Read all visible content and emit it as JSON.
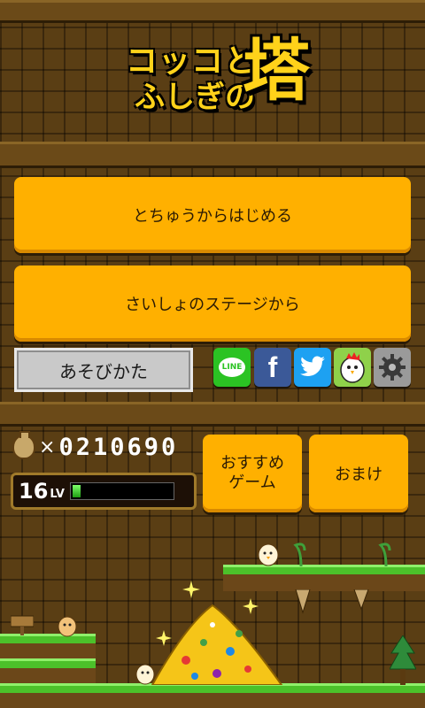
{
  "title": {
    "line1": "コッコと",
    "line2": "ふしぎの",
    "big": "塔"
  },
  "menu": {
    "continue_label": "とちゅうからはじめる",
    "start_label": "さいしょのステージから",
    "howto_label": "あそびかた"
  },
  "social": {
    "line_label": "LINE",
    "facebook_label": "f"
  },
  "status": {
    "coins_x": "×",
    "coins": "0210690",
    "level": "16",
    "level_unit": "LV",
    "level_progress": 0.08
  },
  "buttons": {
    "recommend_label_1": "おすすめ",
    "recommend_label_2": "ゲーム",
    "extra_label": "おまけ"
  },
  "colors": {
    "button": "#ffb000",
    "grass": "#4cc12a",
    "gold": "#ffd21a"
  },
  "icons": [
    "line-icon",
    "facebook-icon",
    "twitter-icon",
    "chicken-icon",
    "gear-icon"
  ]
}
